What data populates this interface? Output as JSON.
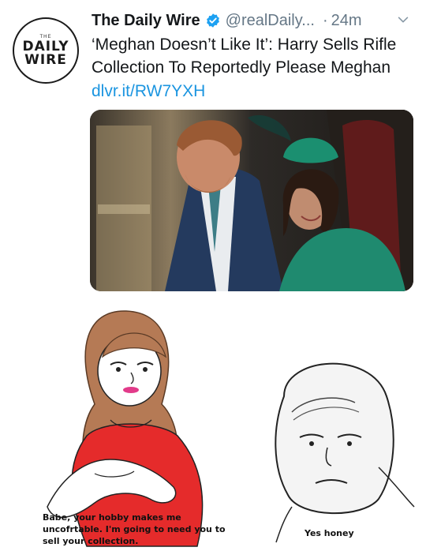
{
  "tweet": {
    "logo": {
      "small": "THE",
      "line1": "DAILY",
      "line2": "WIRE"
    },
    "account_name": "The Daily Wire",
    "handle": "@realDaily...",
    "separator": "·",
    "time": "24m",
    "text": "‘Meghan Doesn’t Like It’: Harry Sells Rifle Collection To Reportedly Please Meghan",
    "link": "dlvr.it/RW7YXH",
    "icons": [
      "verified-badge-icon",
      "chevron-down-icon"
    ],
    "colors": {
      "link": "#1b95e0",
      "muted": "#657786",
      "verified": "#1da1f2"
    }
  },
  "meme": {
    "left_caption": "Babe, your hobby makes me uncofrtable. I'm going to need you to sell your collection.",
    "right_caption": "Yes honey"
  }
}
